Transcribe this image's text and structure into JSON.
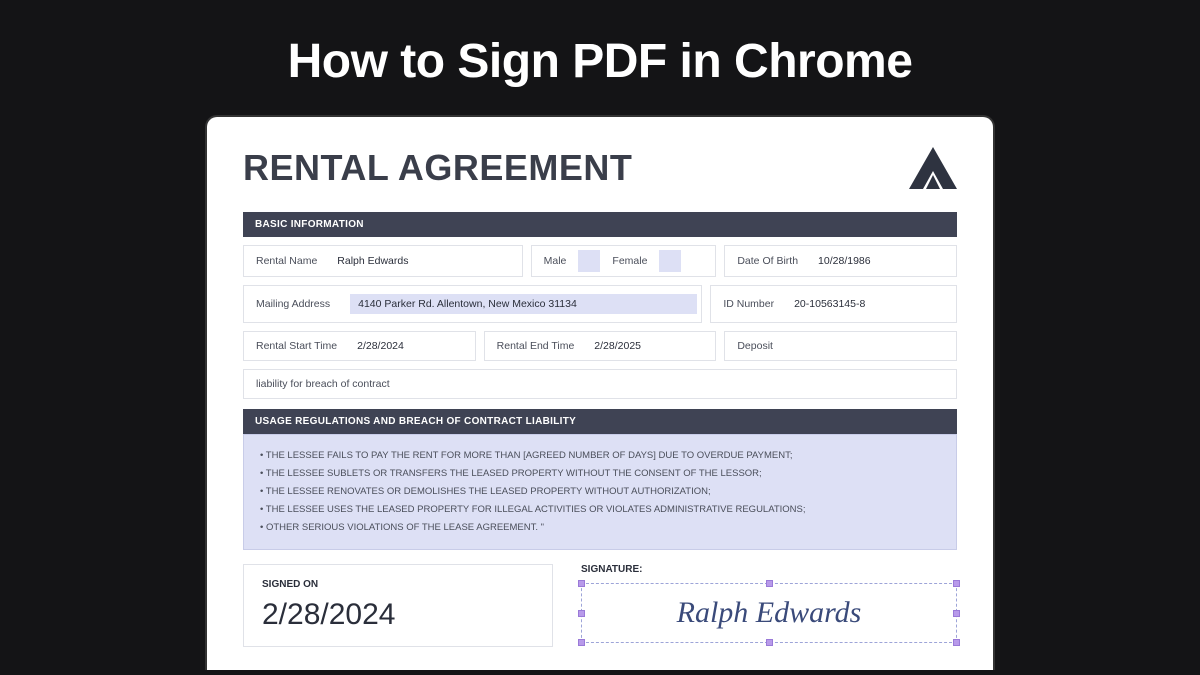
{
  "page_title": "How to Sign PDF in Chrome",
  "document": {
    "title": "RENTAL AGREEMENT",
    "sections": {
      "basic": {
        "header": "BASIC INFORMATION",
        "rental_name_label": "Rental Name",
        "rental_name_value": "Ralph Edwards",
        "male_label": "Male",
        "female_label": "Female",
        "dob_label": "Date Of Birth",
        "dob_value": "10/28/1986",
        "mailing_label": "Mailing Address",
        "mailing_value": "4140 Parker Rd. Allentown, New Mexico 31134",
        "id_label": "ID Number",
        "id_value": "20-10563145-8",
        "start_label": "Rental Start Time",
        "start_value": "2/28/2024",
        "end_label": "Rental End Time",
        "end_value": "2/28/2025",
        "deposit_label": "Deposit",
        "liability_text": "liability for breach of contract"
      },
      "regulations": {
        "header": "USAGE REGULATIONS AND BREACH OF CONTRACT LIABILITY",
        "items": [
          "THE LESSEE FAILS TO PAY THE RENT FOR MORE THAN [AGREED NUMBER OF DAYS] DUE TO OVERDUE PAYMENT;",
          "THE LESSEE SUBLETS OR TRANSFERS THE LEASED PROPERTY WITHOUT THE CONSENT OF THE LESSOR;",
          "THE LESSEE RENOVATES OR DEMOLISHES THE LEASED PROPERTY WITHOUT AUTHORIZATION;",
          "THE LESSEE USES THE LEASED PROPERTY FOR ILLEGAL ACTIVITIES OR VIOLATES ADMINISTRATIVE REGULATIONS;",
          "OTHER SERIOUS VIOLATIONS OF THE LEASE AGREEMENT. \""
        ]
      }
    },
    "signed": {
      "label": "SIGNED ON",
      "date": "2/28/2024"
    },
    "signature": {
      "label": "SIGNATURE:",
      "value": "Ralph Edwards"
    }
  }
}
